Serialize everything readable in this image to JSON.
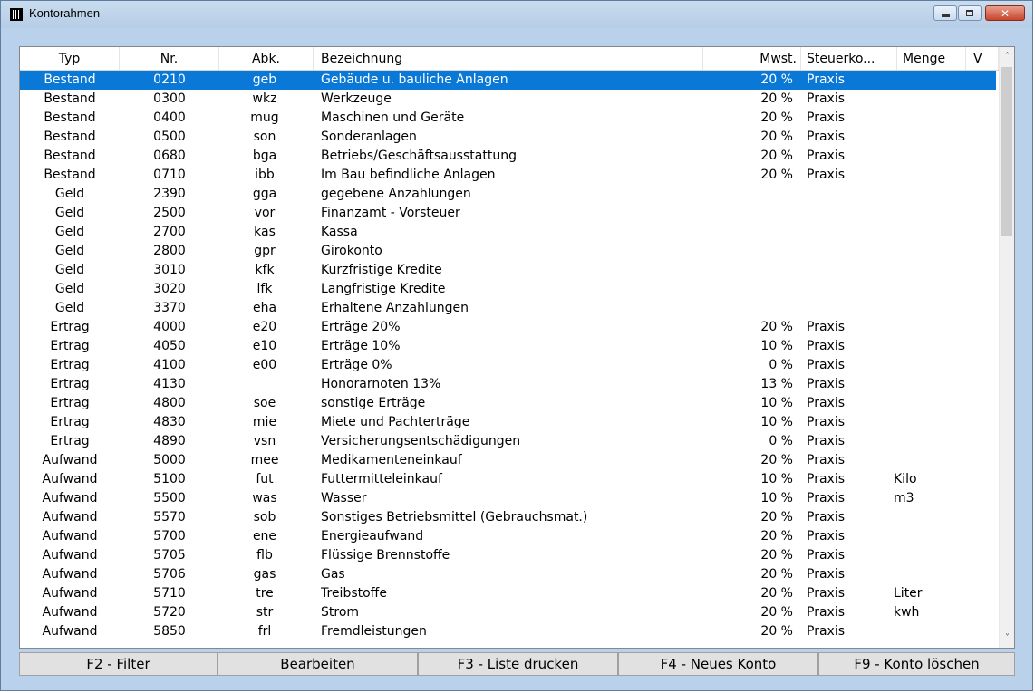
{
  "window": {
    "title": "Kontorahmen",
    "buttons": {
      "minimize": "minimize",
      "maximize": "maximize",
      "close": "✕"
    }
  },
  "columns": [
    "Typ",
    "Nr.",
    "Abk.",
    "Bezeichnung",
    "Mwst.",
    "Steuerko...",
    "Menge",
    "V"
  ],
  "rows": [
    {
      "typ": "Bestand",
      "nr": "0210",
      "abk": "geb",
      "bez": "Gebäude u. bauliche Anlagen",
      "mwst": "20 %",
      "steuer": "Praxis",
      "menge": "",
      "selected": true
    },
    {
      "typ": "Bestand",
      "nr": "0300",
      "abk": "wkz",
      "bez": "Werkzeuge",
      "mwst": "20 %",
      "steuer": "Praxis",
      "menge": ""
    },
    {
      "typ": "Bestand",
      "nr": "0400",
      "abk": "mug",
      "bez": "Maschinen und Geräte",
      "mwst": "20 %",
      "steuer": "Praxis",
      "menge": ""
    },
    {
      "typ": "Bestand",
      "nr": "0500",
      "abk": "son",
      "bez": "Sonderanlagen",
      "mwst": "20 %",
      "steuer": "Praxis",
      "menge": ""
    },
    {
      "typ": "Bestand",
      "nr": "0680",
      "abk": "bga",
      "bez": "Betriebs/Geschäftsausstattung",
      "mwst": "20 %",
      "steuer": "Praxis",
      "menge": ""
    },
    {
      "typ": "Bestand",
      "nr": "0710",
      "abk": "ibb",
      "bez": "Im Bau befindliche Anlagen",
      "mwst": "20 %",
      "steuer": "Praxis",
      "menge": ""
    },
    {
      "typ": "Geld",
      "nr": "2390",
      "abk": "gga",
      "bez": "gegebene Anzahlungen",
      "mwst": "",
      "steuer": "",
      "menge": ""
    },
    {
      "typ": "Geld",
      "nr": "2500",
      "abk": "vor",
      "bez": "Finanzamt - Vorsteuer",
      "mwst": "",
      "steuer": "",
      "menge": ""
    },
    {
      "typ": "Geld",
      "nr": "2700",
      "abk": "kas",
      "bez": "Kassa",
      "mwst": "",
      "steuer": "",
      "menge": ""
    },
    {
      "typ": "Geld",
      "nr": "2800",
      "abk": "gpr",
      "bez": "Girokonto",
      "mwst": "",
      "steuer": "",
      "menge": ""
    },
    {
      "typ": "Geld",
      "nr": "3010",
      "abk": "kfk",
      "bez": "Kurzfristige Kredite",
      "mwst": "",
      "steuer": "",
      "menge": ""
    },
    {
      "typ": "Geld",
      "nr": "3020",
      "abk": "lfk",
      "bez": "Langfristige Kredite",
      "mwst": "",
      "steuer": "",
      "menge": ""
    },
    {
      "typ": "Geld",
      "nr": "3370",
      "abk": "eha",
      "bez": "Erhaltene Anzahlungen",
      "mwst": "",
      "steuer": "",
      "menge": ""
    },
    {
      "typ": "Ertrag",
      "nr": "4000",
      "abk": "e20",
      "bez": "Erträge 20%",
      "mwst": "20 %",
      "steuer": "Praxis",
      "menge": ""
    },
    {
      "typ": "Ertrag",
      "nr": "4050",
      "abk": "e10",
      "bez": "Erträge 10%",
      "mwst": "10 %",
      "steuer": "Praxis",
      "menge": ""
    },
    {
      "typ": "Ertrag",
      "nr": "4100",
      "abk": "e00",
      "bez": "Erträge 0%",
      "mwst": "0 %",
      "steuer": "Praxis",
      "menge": ""
    },
    {
      "typ": "Ertrag",
      "nr": "4130",
      "abk": "",
      "bez": "Honorarnoten 13%",
      "mwst": "13 %",
      "steuer": "Praxis",
      "menge": ""
    },
    {
      "typ": "Ertrag",
      "nr": "4800",
      "abk": "soe",
      "bez": "sonstige Erträge",
      "mwst": "10 %",
      "steuer": "Praxis",
      "menge": ""
    },
    {
      "typ": "Ertrag",
      "nr": "4830",
      "abk": "mie",
      "bez": "Miete und Pachterträge",
      "mwst": "10 %",
      "steuer": "Praxis",
      "menge": ""
    },
    {
      "typ": "Ertrag",
      "nr": "4890",
      "abk": "vsn",
      "bez": "Versicherungsentschädigungen",
      "mwst": "0 %",
      "steuer": "Praxis",
      "menge": ""
    },
    {
      "typ": "Aufwand",
      "nr": "5000",
      "abk": "mee",
      "bez": "Medikamenteneinkauf",
      "mwst": "20 %",
      "steuer": "Praxis",
      "menge": ""
    },
    {
      "typ": "Aufwand",
      "nr": "5100",
      "abk": "fut",
      "bez": "Futtermitteleinkauf",
      "mwst": "10 %",
      "steuer": "Praxis",
      "menge": "Kilo"
    },
    {
      "typ": "Aufwand",
      "nr": "5500",
      "abk": "was",
      "bez": "Wasser",
      "mwst": "10 %",
      "steuer": "Praxis",
      "menge": "m3"
    },
    {
      "typ": "Aufwand",
      "nr": "5570",
      "abk": "sob",
      "bez": "Sonstiges Betriebsmittel (Gebrauchsmat.)",
      "mwst": "20 %",
      "steuer": "Praxis",
      "menge": ""
    },
    {
      "typ": "Aufwand",
      "nr": "5700",
      "abk": "ene",
      "bez": "Energieaufwand",
      "mwst": "20 %",
      "steuer": "Praxis",
      "menge": ""
    },
    {
      "typ": "Aufwand",
      "nr": "5705",
      "abk": "flb",
      "bez": "Flüssige Brennstoffe",
      "mwst": "20 %",
      "steuer": "Praxis",
      "menge": ""
    },
    {
      "typ": "Aufwand",
      "nr": "5706",
      "abk": "gas",
      "bez": "Gas",
      "mwst": "20 %",
      "steuer": "Praxis",
      "menge": ""
    },
    {
      "typ": "Aufwand",
      "nr": "5710",
      "abk": "tre",
      "bez": "Treibstoffe",
      "mwst": "20 %",
      "steuer": "Praxis",
      "menge": "Liter"
    },
    {
      "typ": "Aufwand",
      "nr": "5720",
      "abk": "str",
      "bez": "Strom",
      "mwst": "20 %",
      "steuer": "Praxis",
      "menge": "kwh"
    },
    {
      "typ": "Aufwand",
      "nr": "5850",
      "abk": "frl",
      "bez": "Fremdleistungen",
      "mwst": "20 %",
      "steuer": "Praxis",
      "menge": ""
    }
  ],
  "buttons": [
    "F2 - Filter",
    "Bearbeiten",
    "F3 - Liste drucken",
    "F4 - Neues Konto",
    "F9 - Konto löschen"
  ],
  "icons": {
    "app": "ledger-icon",
    "scroll_up": "chevron-up-icon",
    "scroll_down": "chevron-down-icon"
  },
  "colors": {
    "selection": "#0a78d7",
    "window_frame": "#b9d1ea",
    "close_button": "#c8442b"
  }
}
